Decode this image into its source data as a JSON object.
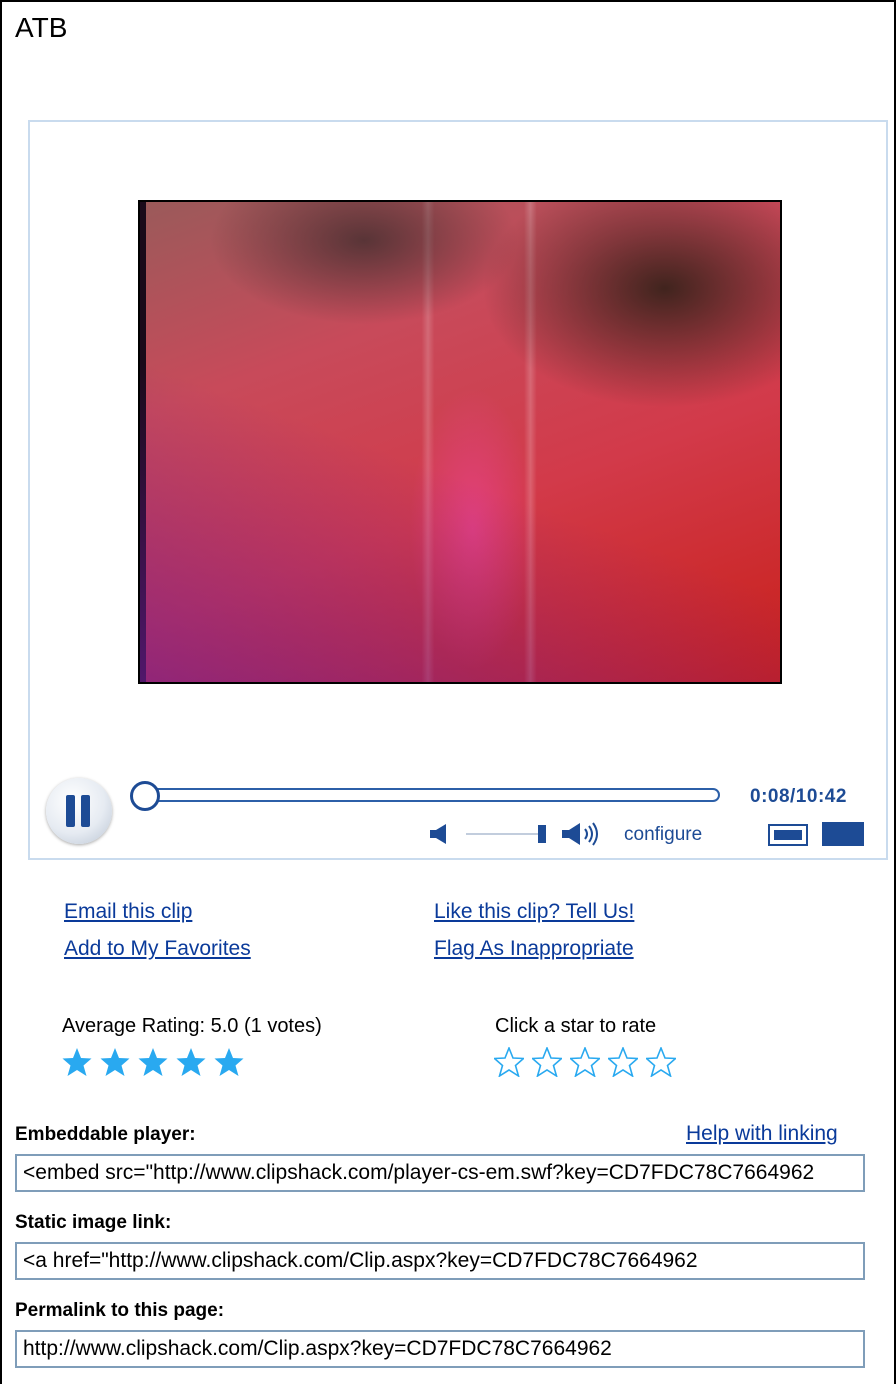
{
  "page": {
    "title": "ATB"
  },
  "player": {
    "time_display": "0:08/10:42",
    "progress_fraction": 0.0125,
    "volume_fraction": 0.95,
    "configure_label": "configure",
    "pause_icon": "pause-icon",
    "volume_low_icon": "speaker-low-icon",
    "volume_high_icon": "speaker-high-icon",
    "accent_color": "#1d4b95"
  },
  "links": {
    "email": "Email this clip",
    "favorites": "Add to My Favorites",
    "like": "Like this clip? Tell Us!",
    "flag": "Flag As Inappropriate"
  },
  "rating": {
    "average_label": "Average Rating: 5.0 (1 votes)",
    "average_stars": 5,
    "max_stars": 5,
    "rate_prompt": "Click a star to rate",
    "star_color": "#29a9f0"
  },
  "embed": {
    "player_label": "Embeddable player:",
    "help_link": "Help with linking",
    "player_code": "<embed src=\"http://www.clipshack.com/player-cs-em.swf?key=CD7FDC78C7664962",
    "static_label": "Static image link:",
    "static_code": "<a href=\"http://www.clipshack.com/Clip.aspx?key=CD7FDC78C7664962",
    "permalink_label": "Permalink to this page:",
    "permalink_code": "http://www.clipshack.com/Clip.aspx?key=CD7FDC78C7664962"
  }
}
